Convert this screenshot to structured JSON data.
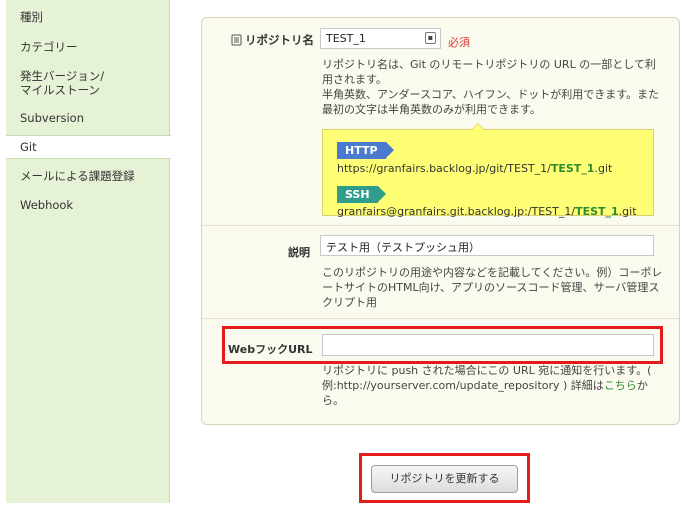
{
  "sidebar": {
    "items": [
      {
        "label": "種別"
      },
      {
        "label": "カテゴリー"
      },
      {
        "label": "発生バージョン/"
      },
      {
        "label": "マイルストーン"
      },
      {
        "label": "Subversion"
      },
      {
        "label": "Git"
      },
      {
        "label": "メールによる課題登録"
      },
      {
        "label": "Webhook"
      }
    ]
  },
  "form": {
    "repo_label": "リポジトリ名",
    "repo_value": "TEST_1",
    "required": "必須",
    "repo_help": [
      "リポジトリ名は、Git のリモートリポジトリの URL の一部として利",
      "用されます。",
      "半角英数、アンダースコア、ハイフン、ドットが利用できます。また",
      "最初の文字は半角英数のみが利用できます。"
    ],
    "http_tag": "HTTP",
    "http_url_prefix": "https://granfairs.backlog.jp/git/TEST_1/",
    "http_url_bold": "TEST_1",
    "http_url_suffix": ".git",
    "ssh_tag": "SSH",
    "ssh_url_prefix": "granfairs@granfairs.git.backlog.jp:/TEST_1/",
    "ssh_url_bold": "TEST_1",
    "ssh_url_suffix": ".git",
    "desc_label": "説明",
    "desc_value": "テスト用（テストプッシュ用）",
    "desc_help": [
      "このリポジトリの用途や内容などを記載してください。例）コーポレ",
      "ートサイトのHTML向け、アプリのソースコード管理、サーバ管理ス",
      "クリプト用"
    ],
    "webhook_label": "WebフックURL",
    "webhook_value": "",
    "webhook_help_1": "リポジトリに push された場合にこの URL 宛に通知を行います。(",
    "webhook_help_2": "例:http://yourserver.com/update_repository ) 詳細は",
    "webhook_link": "こちら",
    "webhook_help_3": "か",
    "webhook_help_4": "ら。"
  },
  "submit_label": "リポジトリを更新する",
  "colors": {
    "sidebar_bg": "#e6f2d6",
    "panel_bg": "#fbfaee",
    "url_box_bg": "#ffff75",
    "http_tag": "#4b7bd1",
    "ssh_tag": "#2f9c8c",
    "highlight": "#e21b1b",
    "required": "#d23a3a",
    "link": "#2e8b2e"
  }
}
